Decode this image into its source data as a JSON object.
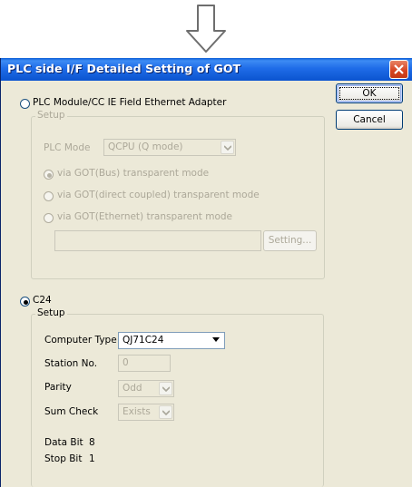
{
  "window": {
    "title": "PLC side I/F Detailed Setting of GOT"
  },
  "buttons": {
    "ok": "OK",
    "cancel": "Cancel"
  },
  "plc_section": {
    "radio_label": "PLC Module/CC IE Field Ethernet Adapter",
    "setup_label": "Setup",
    "plc_mode_label": "PLC Mode",
    "plc_mode_value": "QCPU (Q mode)",
    "option_bus": "via GOT(Bus) transparent mode",
    "option_direct": "via GOT(direct coupled) transparent mode",
    "option_ethernet": "via GOT(Ethernet) transparent mode",
    "setting_button": "Setting..."
  },
  "c24_section": {
    "radio_label": "C24",
    "setup_label": "Setup",
    "computer_type_label": "Computer Type",
    "computer_type_value": "QJ71C24",
    "station_no_label": "Station No.",
    "station_no_value": "0",
    "parity_label": "Parity",
    "parity_value": "Odd",
    "sum_check_label": "Sum Check",
    "sum_check_value": "Exists",
    "data_bit_label": "Data Bit",
    "data_bit_value": "8",
    "stop_bit_label": "Stop Bit",
    "stop_bit_value": "1"
  },
  "colors": {
    "title_bar": "#0b54cf",
    "dialog_bg": "#ece9d8",
    "close_button": "#d5421f",
    "disabled_text": "#aca899"
  }
}
